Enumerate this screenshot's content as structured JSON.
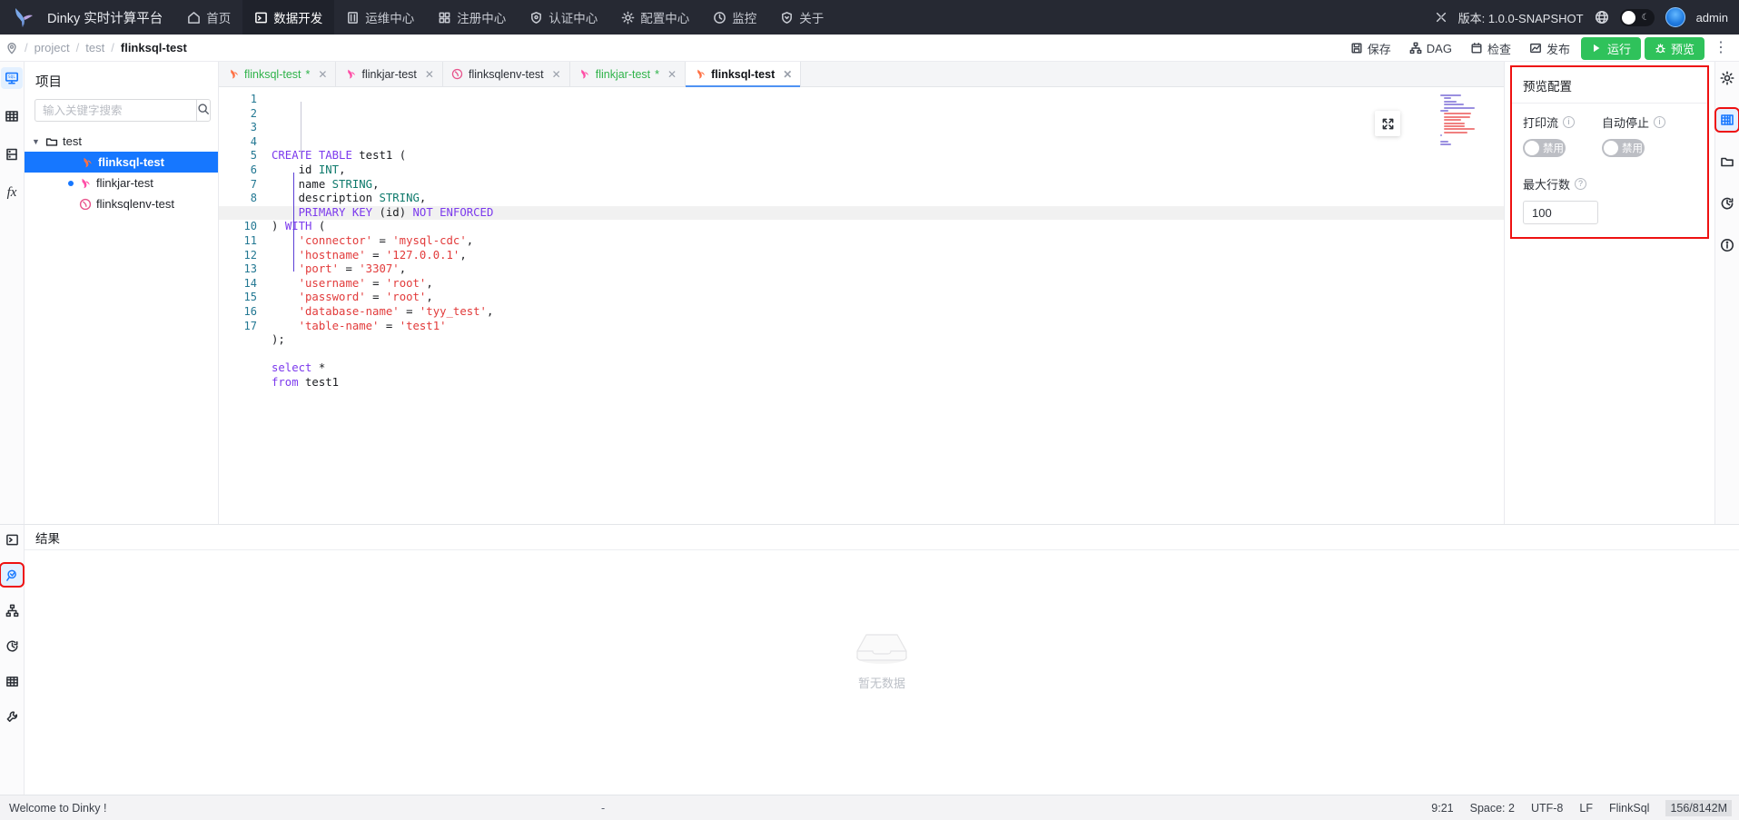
{
  "topnav": {
    "brand": "Dinky 实时计算平台",
    "items": [
      {
        "label": "首页",
        "icon": "home-icon",
        "active": false
      },
      {
        "label": "数据开发",
        "icon": "code-icon",
        "active": true
      },
      {
        "label": "运维中心",
        "icon": "ops-icon",
        "active": false
      },
      {
        "label": "注册中心",
        "icon": "grid-icon",
        "active": false
      },
      {
        "label": "认证中心",
        "icon": "shield-icon",
        "active": false
      },
      {
        "label": "配置中心",
        "icon": "gear-icon",
        "active": false
      },
      {
        "label": "监控",
        "icon": "monitor-icon",
        "active": false
      },
      {
        "label": "关于",
        "icon": "info-shield-icon",
        "active": false
      }
    ],
    "version": "版本: 1.0.0-SNAPSHOT",
    "username": "admin"
  },
  "breadcrumb": {
    "parts": [
      "project",
      "test"
    ],
    "current": "flinksql-test"
  },
  "actions": {
    "save": "保存",
    "dag": "DAG",
    "check": "检查",
    "publish": "发布",
    "run": "运行",
    "preview": "预览",
    "more": "⋮",
    "run_color": "#2fc25b"
  },
  "leftrail": {
    "items": [
      {
        "name": "sql-catalog-icon",
        "selected": true
      },
      {
        "name": "table-icon",
        "selected": false
      },
      {
        "name": "database-icon",
        "selected": false
      },
      {
        "name": "function-icon",
        "selected": false
      }
    ]
  },
  "project": {
    "title": "项目",
    "search_placeholder": "输入关键字搜索",
    "search_value": "",
    "tree": [
      {
        "label": "test",
        "type": "folder",
        "depth": 0,
        "expanded": true,
        "selected": false,
        "dot": false
      },
      {
        "label": "flinksql-test",
        "type": "flinksql",
        "depth": 1,
        "selected": true,
        "dot": false
      },
      {
        "label": "flinkjar-test",
        "type": "flinkjar",
        "depth": 1,
        "selected": false,
        "dot": true
      },
      {
        "label": "flinksqlenv-test",
        "type": "flinksqlenv",
        "depth": 1,
        "selected": false,
        "dot": false
      }
    ]
  },
  "tabs": [
    {
      "label": "flinksql-test",
      "dirty": true,
      "kind": "sql",
      "active": false
    },
    {
      "label": "flinkjar-test",
      "dirty": false,
      "kind": "jar",
      "active": false
    },
    {
      "label": "flinksqlenv-test",
      "dirty": false,
      "kind": "env",
      "active": false
    },
    {
      "label": "flinkjar-test",
      "dirty": true,
      "kind": "jar",
      "active": false
    },
    {
      "label": "flinksql-test",
      "dirty": false,
      "kind": "sql",
      "active": true
    }
  ],
  "editor": {
    "current_line": 9,
    "lines": [
      {
        "n": 1,
        "text": "CREATE TABLE test1 ("
      },
      {
        "n": 2,
        "text": "    id INT,"
      },
      {
        "n": 3,
        "text": "    name STRING,"
      },
      {
        "n": 4,
        "text": "    description STRING,"
      },
      {
        "n": 5,
        "text": "    PRIMARY KEY (id) NOT ENFORCED"
      },
      {
        "n": 6,
        "text": ") WITH ("
      },
      {
        "n": 7,
        "text": "    'connector' = 'mysql-cdc',"
      },
      {
        "n": 8,
        "text": "    'hostname' = '127.0.0.1',"
      },
      {
        "n": 9,
        "text": "    'port' = '3307',"
      },
      {
        "n": 10,
        "text": "    'username' = 'root',"
      },
      {
        "n": 11,
        "text": "    'password' = 'root',"
      },
      {
        "n": 12,
        "text": "    'database-name' = 'tyy_test',"
      },
      {
        "n": 13,
        "text": "    'table-name' = 'test1'"
      },
      {
        "n": 14,
        "text": ");"
      },
      {
        "n": 15,
        "text": ""
      },
      {
        "n": 16,
        "text": "select *"
      },
      {
        "n": 17,
        "text": "from test1"
      }
    ]
  },
  "config": {
    "title": "预览配置",
    "print_stream": {
      "label": "打印流",
      "toggle": "禁用",
      "enabled": false
    },
    "auto_stop": {
      "label": "自动停止",
      "toggle": "禁用",
      "enabled": false
    },
    "max_rows": {
      "label": "最大行数",
      "value": "100"
    },
    "highlight_color": "#ee1111"
  },
  "rightrail": {
    "items": [
      {
        "name": "gear-icon",
        "selected": false
      },
      {
        "name": "table-config-icon",
        "selected": true
      },
      {
        "name": "folder-icon",
        "selected": false
      },
      {
        "name": "history-icon",
        "selected": false
      },
      {
        "name": "info-icon",
        "selected": false
      }
    ]
  },
  "result": {
    "tab": "结果",
    "empty_text": "暂无数据"
  },
  "bottomrail": {
    "items": [
      {
        "name": "console-icon",
        "selected": false
      },
      {
        "name": "search-preview-icon",
        "selected": true
      },
      {
        "name": "lineage-icon",
        "selected": false
      },
      {
        "name": "history-icon",
        "selected": false
      },
      {
        "name": "table-result-icon",
        "selected": false
      },
      {
        "name": "tools-icon",
        "selected": false
      }
    ]
  },
  "status": {
    "left": "Welcome to Dinky !",
    "mid": "-",
    "cursor": "9:21",
    "space": "Space: 2",
    "encoding": "UTF-8",
    "eol": "LF",
    "language": "FlinkSql",
    "memory": "156/8142M"
  }
}
